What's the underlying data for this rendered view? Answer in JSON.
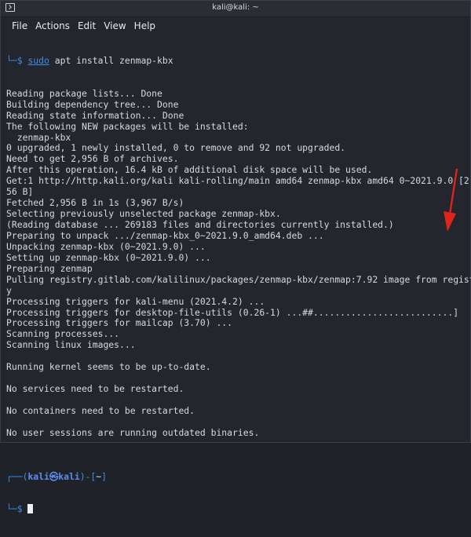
{
  "window": {
    "title": "kali@kali: ~"
  },
  "menu": [
    "File",
    "Actions",
    "Edit",
    "View",
    "Help"
  ],
  "command": {
    "prefix": "└─$ ",
    "sudo": "sudo",
    "rest": " apt install zenmap-kbx"
  },
  "output": [
    "Reading package lists... Done",
    "Building dependency tree... Done",
    "Reading state information... Done",
    "The following NEW packages will be installed:",
    "  zenmap-kbx",
    "0 upgraded, 1 newly installed, 0 to remove and 92 not upgraded.",
    "Need to get 2,956 B of archives.",
    "After this operation, 16.4 kB of additional disk space will be used.",
    "Get:1 http://http.kali.org/kali kali-rolling/main amd64 zenmap-kbx amd64 0~2021.9.0 [2,9",
    "56 B]",
    "Fetched 2,956 B in 1s (3,967 B/s)",
    "Selecting previously unselected package zenmap-kbx.",
    "(Reading database ... 269183 files and directories currently installed.)",
    "Preparing to unpack .../zenmap-kbx_0~2021.9.0_amd64.deb ...",
    "Unpacking zenmap-kbx (0~2021.9.0) ...",
    "Setting up zenmap-kbx (0~2021.9.0) ...",
    "Preparing zenmap",
    "Pulling registry.gitlab.com/kalilinux/packages/zenmap-kbx/zenmap:7.92 image from registr",
    "y",
    "Processing triggers for kali-menu (2021.4.2) ...",
    "Processing triggers for desktop-file-utils (0.26-1) ...##..........................]",
    "Processing triggers for mailcap (3.70) ...",
    "Scanning processes...",
    "Scanning linux images...",
    "",
    "Running kernel seems to be up-to-date.",
    "",
    "No services need to be restarted.",
    "",
    "No containers need to be restarted.",
    "",
    "No user sessions are running outdated binaries.",
    ""
  ],
  "prompt": {
    "top_prefix": "┌──(",
    "user": "kali㉿kali",
    "top_suffix": ")-[",
    "dir": "~",
    "top_end": "]",
    "bottom": "└─$ "
  },
  "colors": {
    "prompt": "#3b8eea",
    "arrow": "#e0231b",
    "background": "#23262d"
  },
  "icons": {
    "window_icon": "terminal-icon",
    "annotation": "red-arrow-icon"
  }
}
